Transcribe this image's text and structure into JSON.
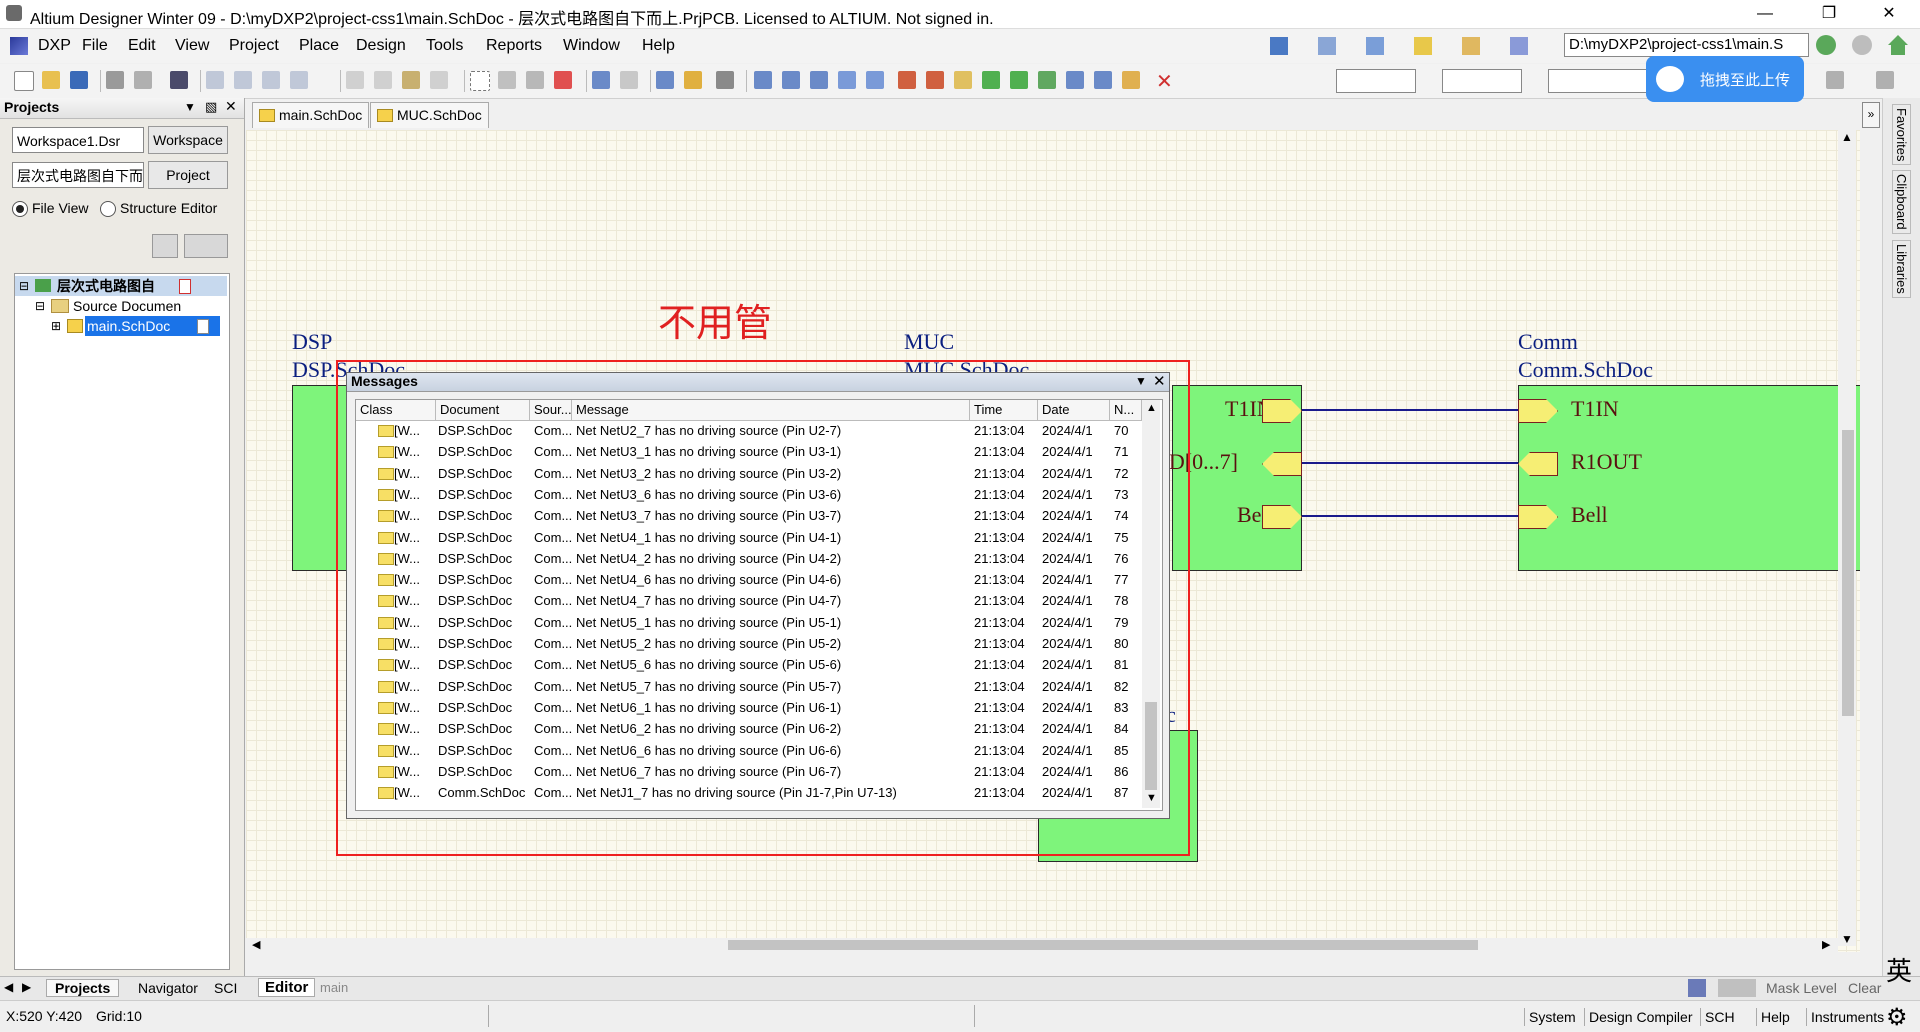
{
  "window": {
    "title": "Altium Designer Winter 09 - D:\\myDXP2\\project-css1\\main.SchDoc - 层次式电路图自下而上.PrjPCB. Licensed to ALTIUM. Not signed in."
  },
  "menu": [
    "DXP",
    "File",
    "Edit",
    "View",
    "Project",
    "Place",
    "Design",
    "Tools",
    "Reports",
    "Window",
    "Help"
  ],
  "toolbar": {
    "path": "D:\\myDXP2\\project-css1\\main.S",
    "upload": "拖拽至此上传"
  },
  "projects_panel": {
    "title": "Projects",
    "workspace_combo": "Workspace1.Dsr",
    "workspace_btn": "Workspace",
    "project_combo": "层次式电路图自下而",
    "project_btn": "Project",
    "file_view": "File View",
    "structure_editor": "Structure Editor",
    "tree": {
      "project": "层次式电路图自",
      "folder": "Source Documen",
      "doc": "main.SchDoc"
    }
  },
  "doc_tabs": [
    "main.SchDoc",
    "MUC.SchDoc"
  ],
  "schematic": {
    "annotation": "不用管",
    "sheets": [
      {
        "name": "DSP",
        "file": "DSP.SchDoc"
      },
      {
        "name": "MUC",
        "file": "MUC.SchDoc"
      },
      {
        "name": "Comm",
        "file": "Comm.SchDoc"
      }
    ],
    "muc_ports": [
      "T1IN",
      "AD[0...7]",
      "Bell"
    ],
    "comm_ports": [
      "T1IN",
      "R1OUT",
      "Bell"
    ],
    "partial_label": "c"
  },
  "messages": {
    "title": "Messages",
    "columns": [
      "Class",
      "Document",
      "Sour...",
      "Message",
      "Time",
      "Date",
      "N..."
    ],
    "rows": [
      {
        "cls": "[W...",
        "doc": "DSP.SchDoc",
        "src": "Com...",
        "msg": "Net NetU2_7 has no driving source (Pin U2-7)",
        "time": "21:13:04",
        "date": "2024/4/1",
        "n": "70"
      },
      {
        "cls": "[W...",
        "doc": "DSP.SchDoc",
        "src": "Com...",
        "msg": "Net NetU3_1 has no driving source (Pin U3-1)",
        "time": "21:13:04",
        "date": "2024/4/1",
        "n": "71"
      },
      {
        "cls": "[W...",
        "doc": "DSP.SchDoc",
        "src": "Com...",
        "msg": "Net NetU3_2 has no driving source (Pin U3-2)",
        "time": "21:13:04",
        "date": "2024/4/1",
        "n": "72"
      },
      {
        "cls": "[W...",
        "doc": "DSP.SchDoc",
        "src": "Com...",
        "msg": "Net NetU3_6 has no driving source (Pin U3-6)",
        "time": "21:13:04",
        "date": "2024/4/1",
        "n": "73"
      },
      {
        "cls": "[W...",
        "doc": "DSP.SchDoc",
        "src": "Com...",
        "msg": "Net NetU3_7 has no driving source (Pin U3-7)",
        "time": "21:13:04",
        "date": "2024/4/1",
        "n": "74"
      },
      {
        "cls": "[W...",
        "doc": "DSP.SchDoc",
        "src": "Com...",
        "msg": "Net NetU4_1 has no driving source (Pin U4-1)",
        "time": "21:13:04",
        "date": "2024/4/1",
        "n": "75"
      },
      {
        "cls": "[W...",
        "doc": "DSP.SchDoc",
        "src": "Com...",
        "msg": "Net NetU4_2 has no driving source (Pin U4-2)",
        "time": "21:13:04",
        "date": "2024/4/1",
        "n": "76"
      },
      {
        "cls": "[W...",
        "doc": "DSP.SchDoc",
        "src": "Com...",
        "msg": "Net NetU4_6 has no driving source (Pin U4-6)",
        "time": "21:13:04",
        "date": "2024/4/1",
        "n": "77"
      },
      {
        "cls": "[W...",
        "doc": "DSP.SchDoc",
        "src": "Com...",
        "msg": "Net NetU4_7 has no driving source (Pin U4-7)",
        "time": "21:13:04",
        "date": "2024/4/1",
        "n": "78"
      },
      {
        "cls": "[W...",
        "doc": "DSP.SchDoc",
        "src": "Com...",
        "msg": "Net NetU5_1 has no driving source (Pin U5-1)",
        "time": "21:13:04",
        "date": "2024/4/1",
        "n": "79"
      },
      {
        "cls": "[W...",
        "doc": "DSP.SchDoc",
        "src": "Com...",
        "msg": "Net NetU5_2 has no driving source (Pin U5-2)",
        "time": "21:13:04",
        "date": "2024/4/1",
        "n": "80"
      },
      {
        "cls": "[W...",
        "doc": "DSP.SchDoc",
        "src": "Com...",
        "msg": "Net NetU5_6 has no driving source (Pin U5-6)",
        "time": "21:13:04",
        "date": "2024/4/1",
        "n": "81"
      },
      {
        "cls": "[W...",
        "doc": "DSP.SchDoc",
        "src": "Com...",
        "msg": "Net NetU5_7 has no driving source (Pin U5-7)",
        "time": "21:13:04",
        "date": "2024/4/1",
        "n": "82"
      },
      {
        "cls": "[W...",
        "doc": "DSP.SchDoc",
        "src": "Com...",
        "msg": "Net NetU6_1 has no driving source (Pin U6-1)",
        "time": "21:13:04",
        "date": "2024/4/1",
        "n": "83"
      },
      {
        "cls": "[W...",
        "doc": "DSP.SchDoc",
        "src": "Com...",
        "msg": "Net NetU6_2 has no driving source (Pin U6-2)",
        "time": "21:13:04",
        "date": "2024/4/1",
        "n": "84"
      },
      {
        "cls": "[W...",
        "doc": "DSP.SchDoc",
        "src": "Com...",
        "msg": "Net NetU6_6 has no driving source (Pin U6-6)",
        "time": "21:13:04",
        "date": "2024/4/1",
        "n": "85"
      },
      {
        "cls": "[W...",
        "doc": "DSP.SchDoc",
        "src": "Com...",
        "msg": "Net NetU6_7 has no driving source (Pin U6-7)",
        "time": "21:13:04",
        "date": "2024/4/1",
        "n": "86"
      },
      {
        "cls": "[W...",
        "doc": "Comm.SchDoc",
        "src": "Com...",
        "msg": "Net NetJ1_7 has no driving source (Pin J1-7,Pin U7-13)",
        "time": "21:13:04",
        "date": "2024/4/1",
        "n": "87"
      }
    ]
  },
  "right_dock": [
    "Favorites",
    "Clipboard",
    "Libraries"
  ],
  "bottom_tabs": {
    "left": [
      "Projects",
      "Navigator",
      "SCI"
    ],
    "editor": [
      "Editor",
      "main"
    ],
    "right": [
      "Mask Level",
      "Clear"
    ],
    "ime": "英"
  },
  "status": {
    "coords": "X:520 Y:420",
    "grid": "Grid:10",
    "buttons": [
      "System",
      "Design Compiler",
      "SCH",
      "Help",
      "Instruments"
    ]
  }
}
